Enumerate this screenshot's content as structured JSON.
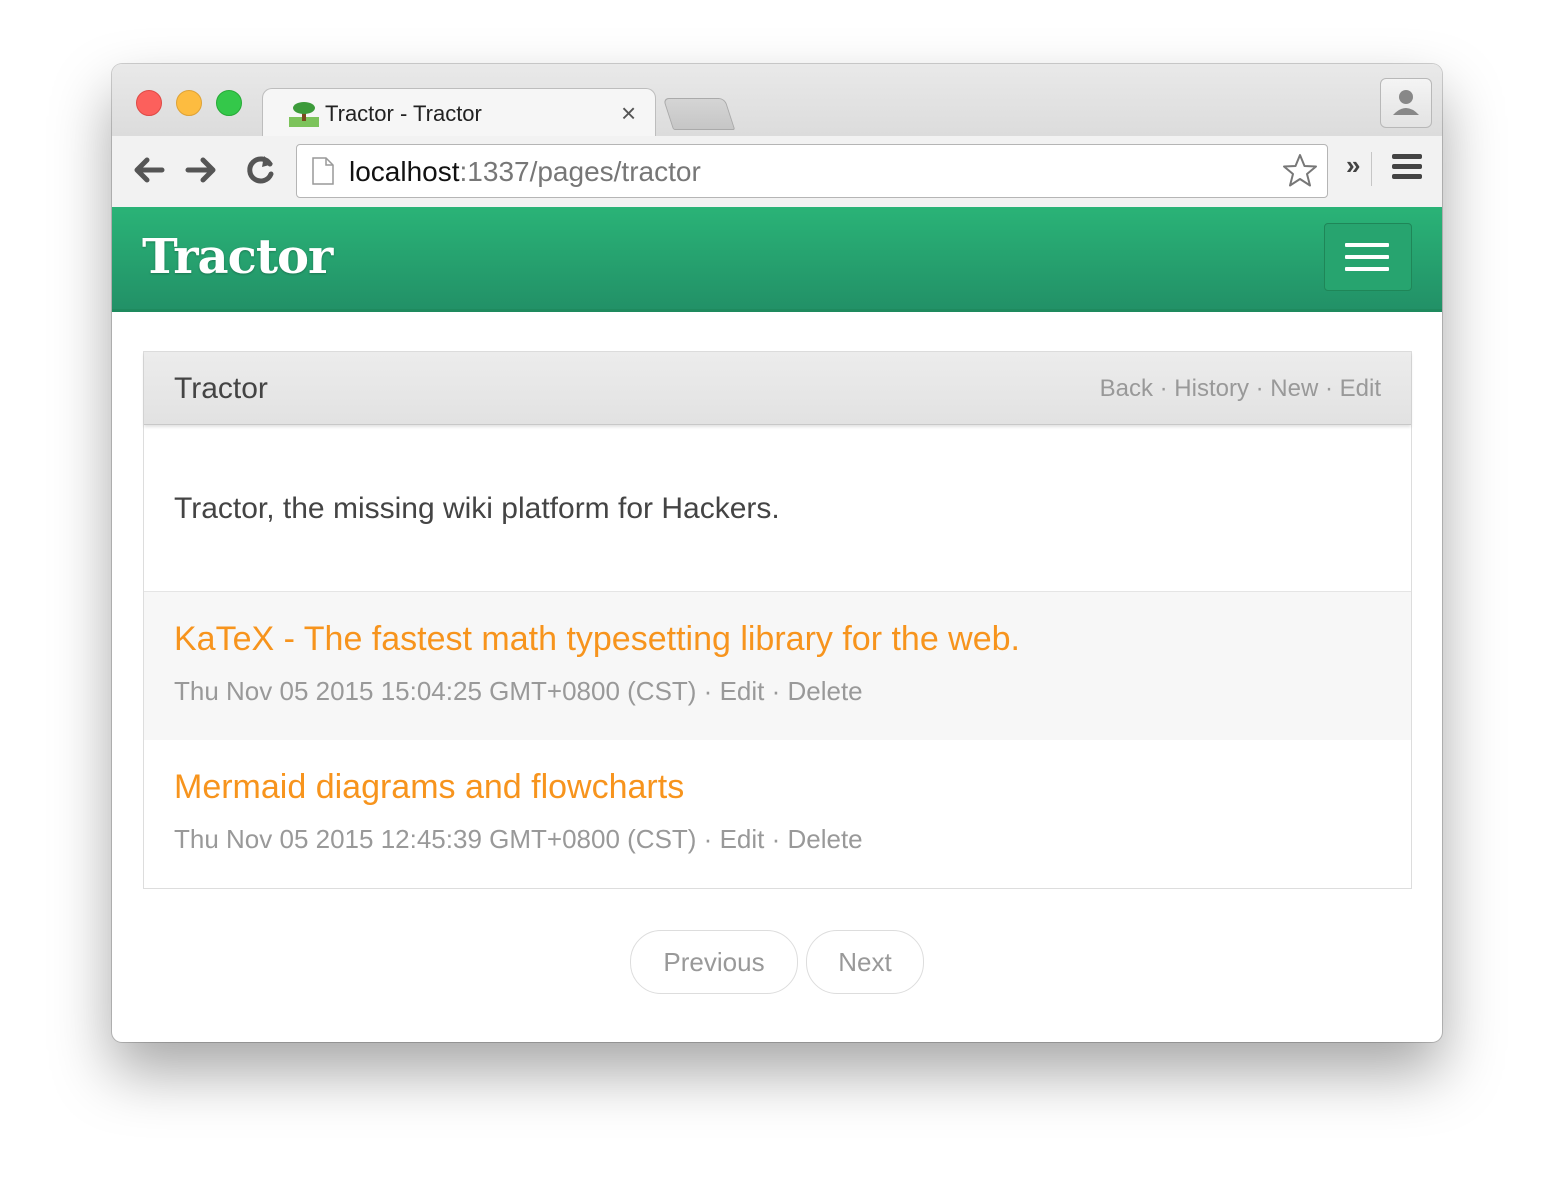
{
  "browser": {
    "tab_title": "Tractor - Tractor",
    "tab_close": "×",
    "url_host": "localhost",
    "url_path": ":1337/pages/tractor",
    "overflow": "»"
  },
  "navbar": {
    "brand": "Tractor"
  },
  "page": {
    "title": "Tractor",
    "actions": {
      "back": "Back",
      "history": "History",
      "new": "New",
      "edit": "Edit",
      "sep": " · "
    },
    "intro": "Tractor, the missing wiki platform for Hackers.",
    "items": [
      {
        "title": "KaTeX - The fastest math typesetting library for the web.",
        "date": "Thu Nov 05 2015 15:04:25 GMT+0800 (CST)",
        "edit": "Edit",
        "delete": "Delete"
      },
      {
        "title": "Mermaid diagrams and flowcharts",
        "date": "Thu Nov 05 2015 12:45:39 GMT+0800 (CST)",
        "edit": "Edit",
        "delete": "Delete"
      }
    ],
    "pager": {
      "previous": "Previous",
      "next": "Next"
    }
  },
  "colors": {
    "navbar": "#2ab377",
    "link": "#f7941d",
    "muted": "#999999"
  }
}
